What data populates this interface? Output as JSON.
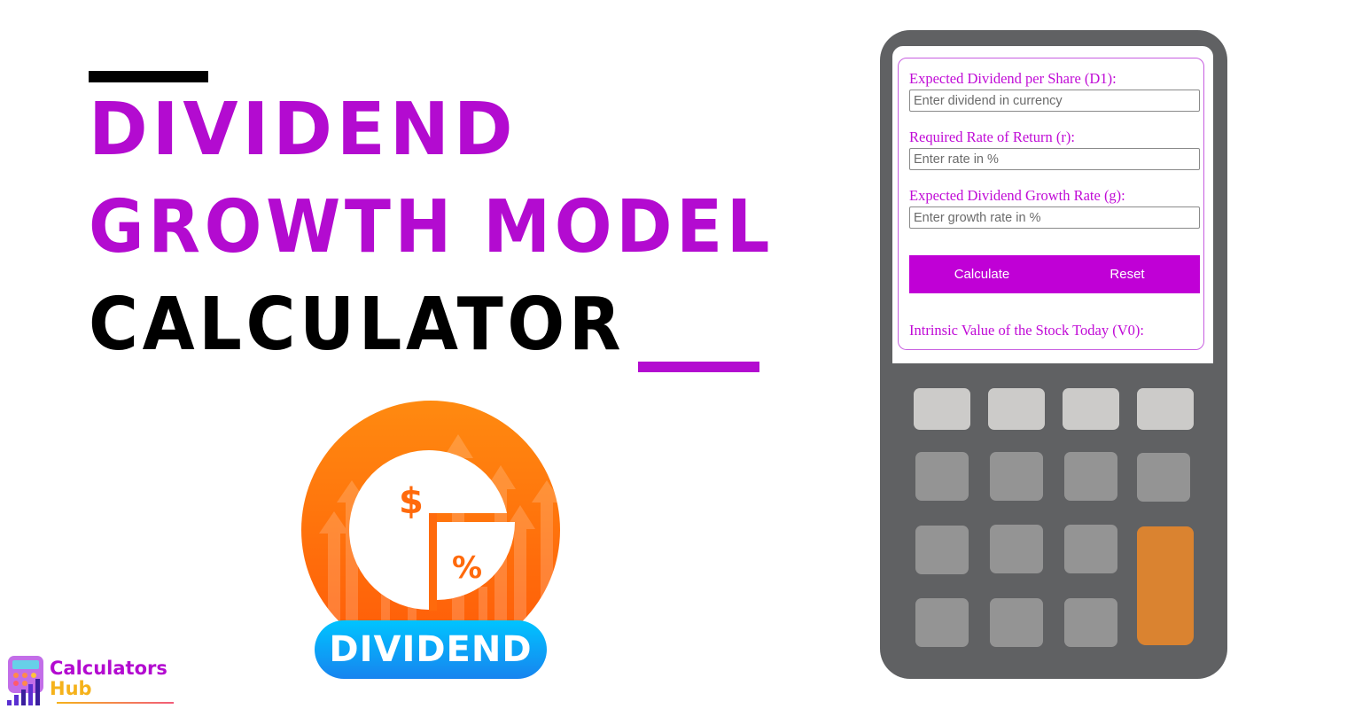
{
  "hero": {
    "title_line1": "DIVIDEND",
    "title_line2": "GROWTH MODEL",
    "title_line3": "CALCULATOR",
    "accent_color": "#b30bd0",
    "text_color": "#000000"
  },
  "badge": {
    "label": "DIVIDEND",
    "dollar_symbol": "$",
    "percent_symbol": "%",
    "icon": "pie-chart-dividend-icon",
    "colors": {
      "circle": "#ff7a10",
      "label_bg": "#1aa8f0"
    }
  },
  "logo": {
    "name_line1": "Calculators",
    "name_line2": "Hub",
    "colors": {
      "line1": "#b30bd0",
      "line2": "#f5b21b"
    }
  },
  "calculator": {
    "fields": [
      {
        "label": "Expected Dividend per Share (D1):",
        "placeholder": "Enter dividend in currency",
        "value": ""
      },
      {
        "label": "Required Rate of Return (r):",
        "placeholder": "Enter rate in %",
        "value": ""
      },
      {
        "label": "Expected Dividend Growth Rate (g):",
        "placeholder": "Enter growth rate in %",
        "value": ""
      }
    ],
    "buttons": {
      "calculate": "Calculate",
      "reset": "Reset"
    },
    "result_label": "Intrinsic Value of the Stock Today (V0):",
    "colors": {
      "body": "#606163",
      "button": "#c000d6",
      "label": "#c00bd6",
      "equals_key": "#da8330"
    }
  }
}
